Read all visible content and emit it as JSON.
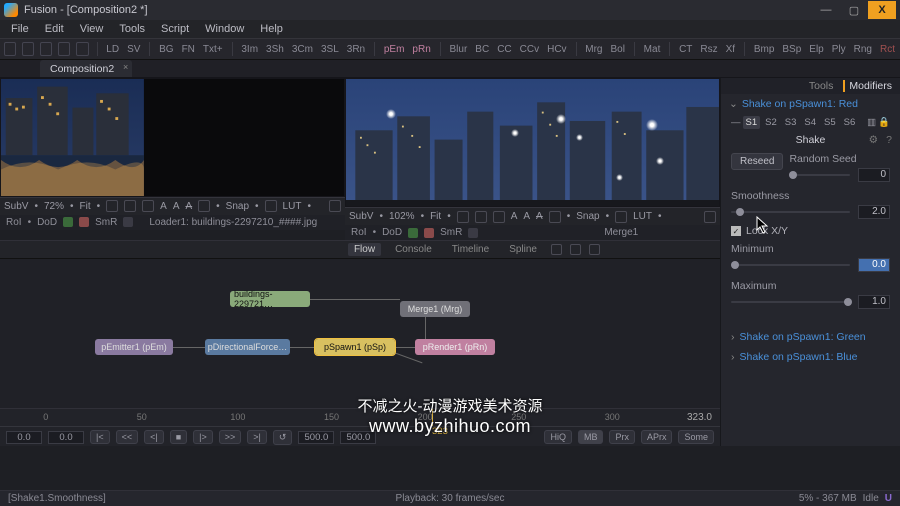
{
  "titlebar": {
    "title": "Fusion - [Composition2 *]",
    "min": "—",
    "max": "▢",
    "close": "X"
  },
  "menubar": [
    "File",
    "Edit",
    "View",
    "Tools",
    "Script",
    "Window",
    "Help"
  ],
  "toolbar": {
    "shortcuts": [
      "LD",
      "SV",
      "BG",
      "FN",
      "Txt+",
      "3Im",
      "3Sh",
      "3Cm",
      "3SL",
      "3Rn",
      "pEm",
      "pRn",
      "Blur",
      "BC",
      "CC",
      "CCv",
      "HCv",
      "Mrg",
      "Bol",
      "Mat",
      "CT",
      "Rsz",
      "Xf",
      "Bmp",
      "BSp",
      "Elp",
      "Ply",
      "Rng",
      "Rct"
    ]
  },
  "doc_tab": "Composition2",
  "viewerL": {
    "sub": "SubV",
    "zoom": "72%",
    "fit": "Fit",
    "snap": "Snap",
    "lut": "LUT",
    "rol": "RoI",
    "dod": "DoD",
    "smr": "SmR",
    "file": "Loader1: buildings-2297210_####.jpg"
  },
  "viewerR": {
    "sub": "SubV",
    "zoom": "102%",
    "fit": "Fit",
    "snap": "Snap",
    "lut": "LUT",
    "rol": "RoI",
    "dod": "DoD",
    "smr": "SmR",
    "file": "Merge1"
  },
  "midtabs": {
    "flow": "Flow",
    "console": "Console",
    "timeline": "Timeline",
    "spline": "Spline"
  },
  "nodes": {
    "buildings": "buildings-229721…",
    "merge": "Merge1  (Mrg)",
    "pemitter": "pEmitter1  (pEm)",
    "pdir": "pDirectionalForce…",
    "pspawn": "pSpawn1  (pSp)",
    "prender": "pRender1  (pRn)"
  },
  "inspector": {
    "tab_tools": "Tools",
    "tab_mods": "Modifiers",
    "hdr": "Shake on pSpawn1: Red",
    "snaps": [
      "S1",
      "S2",
      "S3",
      "S4",
      "S5",
      "S6"
    ],
    "mod_title": "Shake",
    "reseed": "Reseed",
    "random": "Random Seed",
    "random_v": "0",
    "smooth": "Smoothness",
    "smooth_v": "2.0",
    "lockxy": "Lock X/Y",
    "min": "Minimum",
    "min_v": "0.0",
    "max": "Maximum",
    "max_v": "1.0",
    "link_g": "Shake on pSpawn1: Green",
    "link_b": "Shake on pSpawn1: Blue"
  },
  "timeline": {
    "ticks": [
      {
        "v": "0",
        "p": 6
      },
      {
        "v": "50",
        "p": 19
      },
      {
        "v": "100",
        "p": 32
      },
      {
        "v": "150",
        "p": 45
      },
      {
        "v": "200",
        "p": 58
      },
      {
        "v": "250",
        "p": 71
      },
      {
        "v": "300",
        "p": 84
      }
    ],
    "cur": "323",
    "end": "323.0",
    "start": "0.0",
    "in": "0.0",
    "t1": "|<",
    "t2": "<<",
    "t3": "<|",
    "t4": "|>",
    "t5": ">>",
    "t6": ">|",
    "stop": "■",
    "out": "500.0",
    "out2": "500.0",
    "hiq": "HiQ",
    "mb": "MB",
    "prx": "Prx",
    "aprx": "APrx",
    "some": "Some"
  },
  "status": {
    "left": "[Shake1.Smoothness]",
    "mid": "Playback: 30 frames/sec",
    "mem": "5%  -  367 MB",
    "idle": "Idle"
  },
  "watermark": {
    "cn": "不减之火-动漫游戏美术资源",
    "en": "www.byzhihuo.com"
  }
}
